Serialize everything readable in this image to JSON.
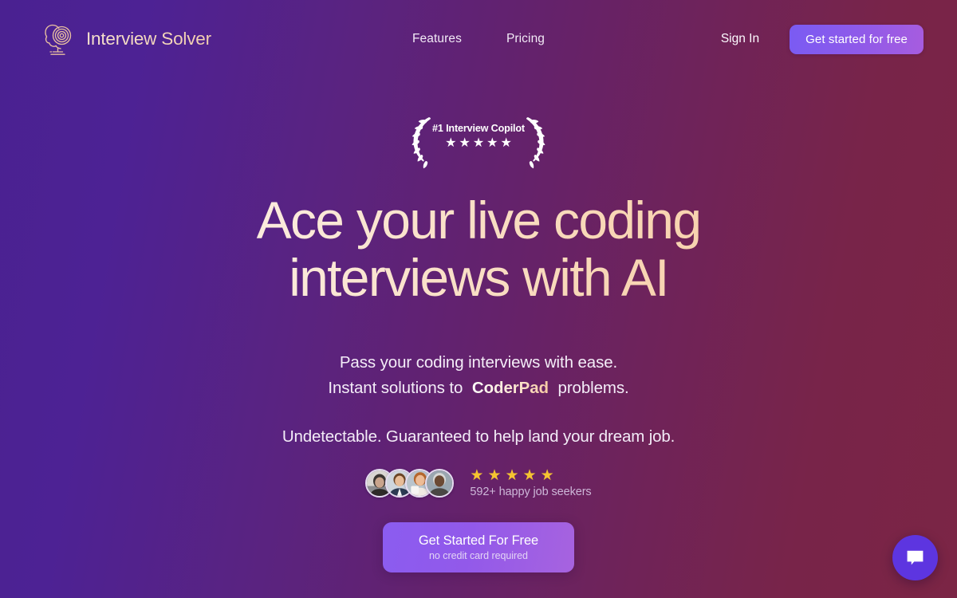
{
  "brand": {
    "name": "Interview Solver",
    "logo_icon": "brain-head-icon"
  },
  "nav": {
    "links": [
      {
        "label": "Features"
      },
      {
        "label": "Pricing"
      }
    ],
    "sign_in_label": "Sign In",
    "cta_label": "Get started for free"
  },
  "hero": {
    "badge": {
      "text": "#1 Interview Copilot",
      "star": "★",
      "star_count": 5,
      "left_icon": "laurel-leaf-left-icon",
      "right_icon": "laurel-leaf-right-icon"
    },
    "headline_line1": "Ace your live coding",
    "headline_line2": "interviews with AI",
    "sub_line1": "Pass your coding interviews with ease.",
    "sub_line2_before": "Instant solutions to",
    "sub_line2_highlight": "CoderPad",
    "sub_line2_after": "problems.",
    "guarantee": "Undetectable. Guaranteed to help land your dream job."
  },
  "social_proof": {
    "avatar_count": 4,
    "avatar_alt": "happy customer photo",
    "star": "★",
    "star_count": 5,
    "label": "592+ happy job seekers"
  },
  "cta": {
    "main_label": "Get Started For Free",
    "sub_label": "no credit card required"
  },
  "chat": {
    "icon": "chat-bubble-icon",
    "label": "Open chat"
  },
  "colors": {
    "bg_left": "#4a2191",
    "bg_right": "#7b2545",
    "accent_purple": "#8b5cf0",
    "star_gold": "#f5c431",
    "headline_cream": "#fdf6ef",
    "headline_peach": "#f5c79c",
    "chat_blue": "#5d35e0"
  }
}
